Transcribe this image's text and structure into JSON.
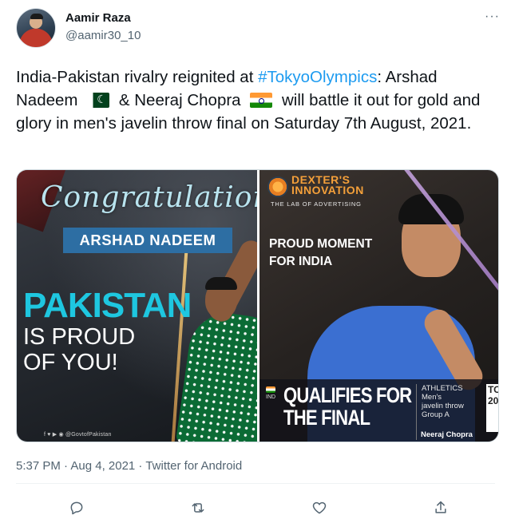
{
  "author": {
    "display_name": "Aamir Raza",
    "handle": "@aamir30_10",
    "more_label": "···"
  },
  "tweet": {
    "text_part1": "India-Pakistan rivalry reignited at ",
    "hashtag": "#TokyoOlympics",
    "text_part2": ": Arshad Nadeem ",
    "text_part3": " & Neeraj Chopra ",
    "text_part4": " will battle it out for gold and glory in men's javelin throw final on Saturday 7th August, 2021."
  },
  "media": {
    "left": {
      "congrats": "Congratulation",
      "name": "ARSHAD NADEEM",
      "headline": "PAKISTAN",
      "subline1": "IS PROUD",
      "subline2": "OF YOU!",
      "footer": "f ♥ ▶ ◉ @GovtofPakistan"
    },
    "right": {
      "brand_line1": "DEXTER'S",
      "brand_line2": "INNOVATION",
      "brand_tag": "THE LAB OF ADVERTISING",
      "headline1": "PROUD MOMENT",
      "headline2": "FOR INDIA",
      "ind": "IND",
      "qualifies1": "QUALIFIES FOR",
      "qualifies2": "THE FINAL",
      "event1": "ATHLETICS",
      "event2": "Men's",
      "event3": "javelin throw",
      "event4": "Group A",
      "athlete": "Neeraj Chopra",
      "tokyo1": "TO",
      "tokyo2": "20"
    }
  },
  "meta": {
    "timestamp": "5:37 PM · Aug 4, 2021 · Twitter for Android"
  },
  "colors": {
    "accent": "#1d9bf0",
    "muted": "#536471"
  }
}
